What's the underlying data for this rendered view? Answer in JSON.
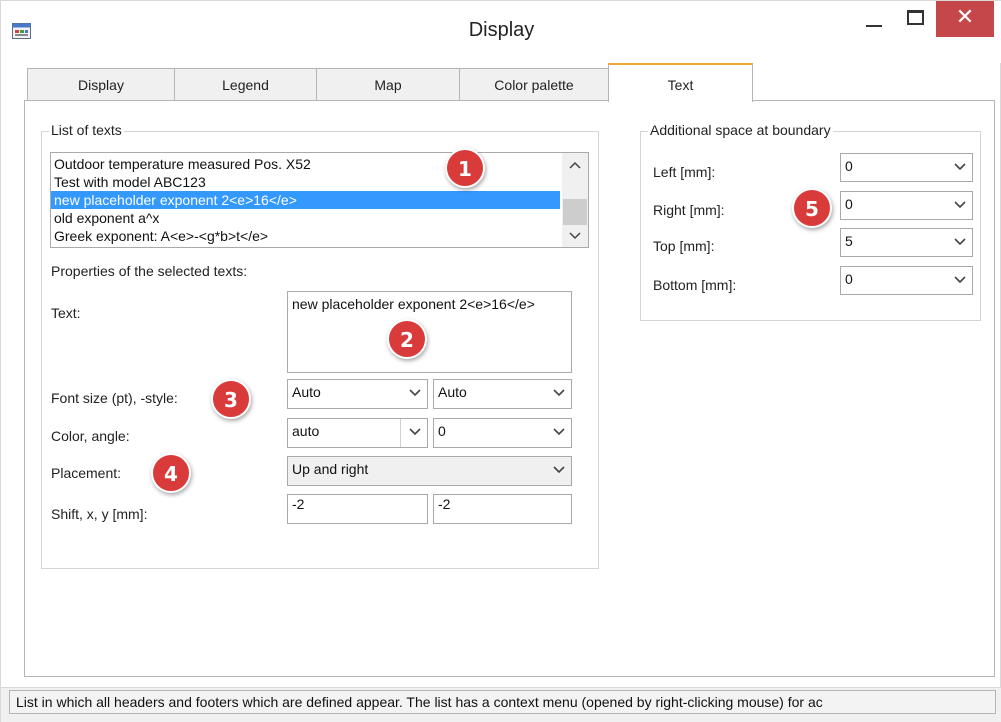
{
  "window": {
    "title": "Display",
    "close_glyph": "✕"
  },
  "tabs": [
    {
      "label": "Display"
    },
    {
      "label": "Legend"
    },
    {
      "label": "Map"
    },
    {
      "label": "Color palette"
    },
    {
      "label": "Text"
    }
  ],
  "list_of_texts": {
    "title": "List of texts",
    "items": [
      "Outdoor temperature measured Pos. X52",
      "Test with model ABC123",
      "new placeholder exponent 2<e>16</e>",
      "old exponent a^x",
      "Greek exponent: A<e>-<g*b>t</e>"
    ],
    "selected_index": 2
  },
  "properties": {
    "heading": "Properties of the selected texts:",
    "text_label": "Text:",
    "text_value": "new placeholder exponent 2<e>16</e>",
    "font_label": "Font size (pt), -style:",
    "font_size": "Auto",
    "font_style": "Auto",
    "color_label": "Color, angle:",
    "color": "auto",
    "angle": "0",
    "placement_label": "Placement:",
    "placement": "Up and right",
    "shift_label": "Shift, x, y [mm]:",
    "shift_x": "-2",
    "shift_y": "-2"
  },
  "boundary": {
    "title": "Additional space at boundary",
    "left_label": "Left [mm]:",
    "left": "0",
    "right_label": "Right [mm]:",
    "right": "0",
    "top_label": "Top [mm]:",
    "top": "5",
    "bottom_label": "Bottom [mm]:",
    "bottom": "0"
  },
  "markers": [
    "1",
    "2",
    "3",
    "4",
    "5"
  ],
  "status": "List in which all headers and footers which are defined appear. The list has a context menu (opened by right-clicking mouse) for ac",
  "colors": {
    "accent_tab": "#f0a830",
    "selection": "#3399ff",
    "close_button": "#c6474a",
    "marker": "#d93b3b"
  }
}
